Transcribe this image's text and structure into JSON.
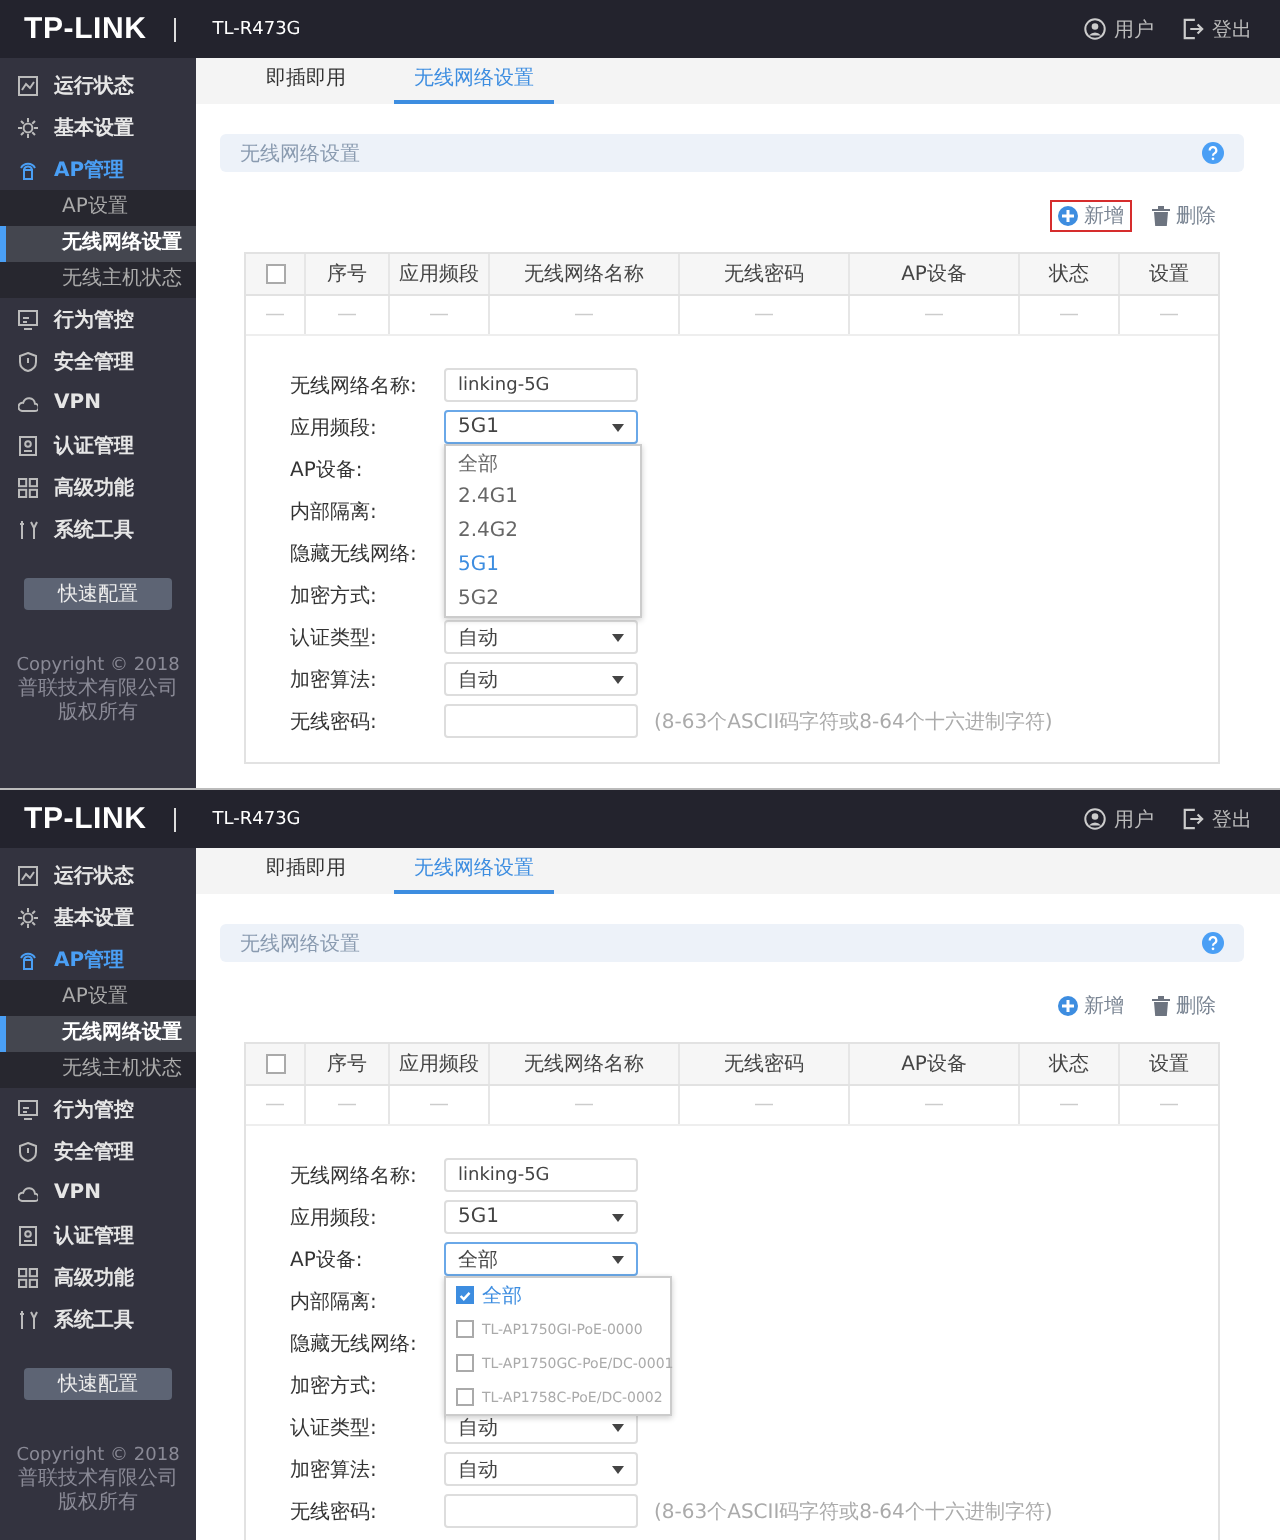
{
  "panels": [
    {
      "header": {
        "logo": "TP-LINK",
        "model": "TL-R473G",
        "user": "用户",
        "logout": "登出"
      },
      "sidebar": {
        "items": [
          {
            "label": "运行状态",
            "selected": false
          },
          {
            "label": "基本设置",
            "selected": false
          },
          {
            "label": "AP管理",
            "selected": true,
            "expanded": true,
            "children": [
              {
                "label": "AP设置",
                "selected": false
              },
              {
                "label": "无线网络设置",
                "selected": true
              },
              {
                "label": "无线主机状态",
                "selected": false
              }
            ]
          },
          {
            "label": "行为管控",
            "selected": false
          },
          {
            "label": "安全管理",
            "selected": false
          },
          {
            "label": "VPN",
            "selected": false
          },
          {
            "label": "认证管理",
            "selected": false
          },
          {
            "label": "高级功能",
            "selected": false
          },
          {
            "label": "系统工具",
            "selected": false
          }
        ],
        "quick_button": "快速配置",
        "copyright": [
          "Copyright © 2018",
          "普联技术有限公司",
          "版权所有"
        ]
      },
      "tabs": [
        {
          "label": "即插即用",
          "selected": false
        },
        {
          "label": "无线网络设置",
          "selected": true
        }
      ],
      "section_title": "无线网络设置",
      "toolbar": {
        "add": "新增",
        "delete": "删除",
        "add_highlighted": true
      },
      "table": {
        "header_checked": false,
        "columns": [
          "",
          "序号",
          "应用频段",
          "无线网络名称",
          "无线密码",
          "AP设备",
          "状态",
          "设置"
        ],
        "rows": [
          [
            "—",
            "—",
            "—",
            "—",
            "—",
            "—",
            "—",
            "—"
          ]
        ]
      },
      "form": [
        {
          "label": "无线网络名称:",
          "kind": "text",
          "value": "linking-5G"
        },
        {
          "label": "应用频段:",
          "kind": "select",
          "value": "5G1",
          "open": true,
          "dropdown": {
            "kind": "list",
            "options": [
              {
                "label": "全部",
                "selected": false
              },
              {
                "label": "2.4G1",
                "selected": false
              },
              {
                "label": "2.4G2",
                "selected": false
              },
              {
                "label": "5G1",
                "selected": true
              },
              {
                "label": "5G2",
                "selected": false
              }
            ]
          }
        },
        {
          "label": "AP设备:",
          "kind": "none"
        },
        {
          "label": "内部隔离:",
          "kind": "none"
        },
        {
          "label": "隐藏无线网络:",
          "kind": "none"
        },
        {
          "label": "加密方式:",
          "kind": "none"
        },
        {
          "label": "认证类型:",
          "kind": "select",
          "value": "自动",
          "open": false
        },
        {
          "label": "加密算法:",
          "kind": "select",
          "value": "自动",
          "open": false
        },
        {
          "label": "无线密码:",
          "kind": "text",
          "hint": "(8-63个ASCII码字符或8-64个十六进制字符)"
        }
      ]
    },
    {
      "header": {
        "logo": "TP-LINK",
        "model": "TL-R473G",
        "user": "用户",
        "logout": "登出"
      },
      "sidebar": {
        "items": [
          {
            "label": "运行状态",
            "selected": false
          },
          {
            "label": "基本设置",
            "selected": false
          },
          {
            "label": "AP管理",
            "selected": true,
            "expanded": true,
            "children": [
              {
                "label": "AP设置",
                "selected": false
              },
              {
                "label": "无线网络设置",
                "selected": true
              },
              {
                "label": "无线主机状态",
                "selected": false
              }
            ]
          },
          {
            "label": "行为管控",
            "selected": false
          },
          {
            "label": "安全管理",
            "selected": false
          },
          {
            "label": "VPN",
            "selected": false
          },
          {
            "label": "认证管理",
            "selected": false
          },
          {
            "label": "高级功能",
            "selected": false
          },
          {
            "label": "系统工具",
            "selected": false
          }
        ],
        "quick_button": "快速配置",
        "copyright": [
          "Copyright © 2018",
          "普联技术有限公司",
          "版权所有"
        ]
      },
      "tabs": [
        {
          "label": "即插即用",
          "selected": false
        },
        {
          "label": "无线网络设置",
          "selected": true
        }
      ],
      "section_title": "无线网络设置",
      "toolbar": {
        "add": "新增",
        "delete": "删除",
        "add_highlighted": false
      },
      "table": {
        "header_checked": false,
        "columns": [
          "",
          "序号",
          "应用频段",
          "无线网络名称",
          "无线密码",
          "AP设备",
          "状态",
          "设置"
        ],
        "rows": [
          [
            "—",
            "—",
            "—",
            "—",
            "—",
            "—",
            "—",
            "—"
          ]
        ]
      },
      "form": [
        {
          "label": "无线网络名称:",
          "kind": "text",
          "value": "linking-5G"
        },
        {
          "label": "应用频段:",
          "kind": "select",
          "value": "5G1",
          "open": false
        },
        {
          "label": "AP设备:",
          "kind": "select",
          "value": "全部",
          "open": true,
          "dropdown": {
            "kind": "checklist",
            "options": [
              {
                "label": "全部",
                "checked": true,
                "disabled": false
              },
              {
                "label": "TL-AP1750GI-PoE-0000",
                "checked": false,
                "disabled": true
              },
              {
                "label": "TL-AP1750GC-PoE/DC-0001",
                "checked": false,
                "disabled": true
              },
              {
                "label": "TL-AP1758C-PoE/DC-0002",
                "checked": false,
                "disabled": true
              }
            ]
          }
        },
        {
          "label": "内部隔离:",
          "kind": "none"
        },
        {
          "label": "隐藏无线网络:",
          "kind": "none"
        },
        {
          "label": "加密方式:",
          "kind": "none"
        },
        {
          "label": "认证类型:",
          "kind": "select",
          "value": "自动",
          "open": false
        },
        {
          "label": "加密算法:",
          "kind": "select",
          "value": "自动",
          "open": false
        },
        {
          "label": "无线密码:",
          "kind": "text",
          "hint": "(8-63个ASCII码字符或8-64个十六进制字符)"
        }
      ]
    }
  ]
}
